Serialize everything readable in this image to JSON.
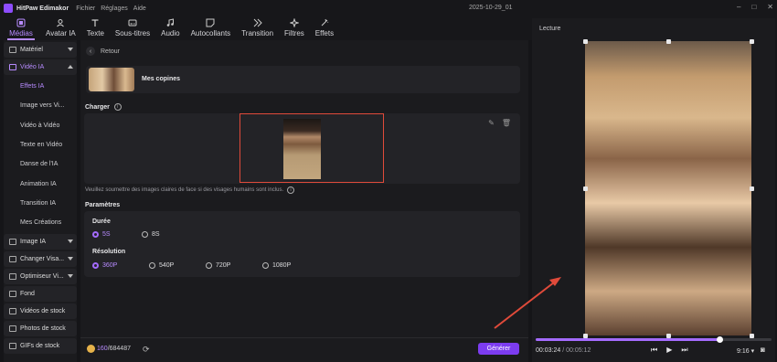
{
  "titlebar": {
    "app_name": "HitPaw Edimakor",
    "menus": [
      "Fichier",
      "Réglages",
      "Aide"
    ],
    "project_date": "2025-10-29_01"
  },
  "toolbar": {
    "items": [
      {
        "label": "Médias",
        "icon": "media-icon",
        "active": true
      },
      {
        "label": "Avatar IA",
        "icon": "avatar-icon"
      },
      {
        "label": "Texte",
        "icon": "text-icon"
      },
      {
        "label": "Sous-titres",
        "icon": "subtitles-icon"
      },
      {
        "label": "Audio",
        "icon": "audio-icon"
      },
      {
        "label": "Autocollants",
        "icon": "sticker-icon"
      },
      {
        "label": "Transition",
        "icon": "transition-icon"
      },
      {
        "label": "Filtres",
        "icon": "filter-icon"
      },
      {
        "label": "Effets",
        "icon": "effects-icon"
      }
    ]
  },
  "sidebar": {
    "categories_top": [
      {
        "label": "Matériel"
      },
      {
        "label": "Vidéo IA",
        "active": true
      }
    ],
    "video_ia_items": [
      "Effets IA",
      "Image vers Vi...",
      "Vidéo à Vidéo",
      "Texte en Vidéo",
      "Danse de l'IA",
      "Animation IA",
      "Transition IA",
      "Mes Créations"
    ],
    "categories_bottom": [
      {
        "label": "Image IA",
        "caret": true
      },
      {
        "label": "Changer Visa...",
        "caret": true
      },
      {
        "label": "Optimiseur Vi...",
        "caret": true
      },
      {
        "label": "Fond",
        "caret": false
      },
      {
        "label": "Vidéos de stock",
        "caret": false
      },
      {
        "label": "Photos de stock",
        "caret": false
      },
      {
        "label": "GIFs de stock",
        "caret": false
      }
    ]
  },
  "center": {
    "back_label": "Retour",
    "effect_name": "Mes copines",
    "charger_label": "Charger",
    "hint": "Veuillez soumettre des images claires de face si des visages humains sont inclus.",
    "params_title": "Paramètres",
    "duration": {
      "label": "Durée",
      "options": [
        "5S",
        "8S"
      ],
      "selected": "5S"
    },
    "resolution": {
      "label": "Résolution",
      "options": [
        "360P",
        "540P",
        "720P",
        "1080P"
      ],
      "selected": "360P"
    },
    "credits": {
      "used": "160",
      "total": "/684487"
    },
    "generate_label": "Générer"
  },
  "preview": {
    "title": "Lecture",
    "time_current": "00:03:24",
    "time_total": " / 00:05:12",
    "progress": 0.78,
    "aspect_ratio": "9:16",
    "accent": "#a46bff"
  }
}
